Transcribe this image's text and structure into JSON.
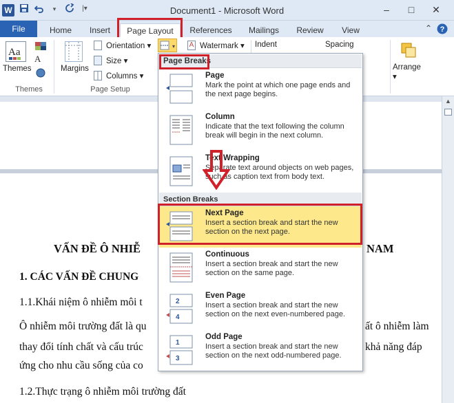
{
  "window": {
    "title": "Document1  -  Microsoft Word",
    "app_icon_letter": "W",
    "controls": [
      "–",
      "□",
      "✕"
    ]
  },
  "tabs": [
    "File",
    "Home",
    "Insert",
    "Page Layout",
    "References",
    "Mailings",
    "Review",
    "View"
  ],
  "ribbon": {
    "themes": {
      "button": "Themes",
      "group": "Themes"
    },
    "page_setup": {
      "margins": "Margins",
      "orientation": "Orientation ▾",
      "size": "Size ▾",
      "columns": "Columns ▾",
      "group": "Page Setup"
    },
    "watermark": "Watermark ▾",
    "indent": "Indent",
    "spacing": "Spacing",
    "arrange": "Arrange ▾"
  },
  "menu": {
    "page_breaks_header": "Page Breaks",
    "section_breaks_header": "Section Breaks",
    "items": [
      {
        "title": "Page",
        "desc": "Mark the point at which one page ends and the next page begins."
      },
      {
        "title": "Column",
        "desc": "Indicate that the text following the column break will begin in the next column."
      },
      {
        "title": "Text Wrapping",
        "desc": "Separate text around objects on web pages, such as caption text from body text."
      },
      {
        "title": "Next Page",
        "desc": "Insert a section break and start the new section on the next page."
      },
      {
        "title": "Continuous",
        "desc": "Insert a section break and start the new section on the same page."
      },
      {
        "title": "Even Page",
        "desc": "Insert a section break and start the new section on the next even-numbered page."
      },
      {
        "title": "Odd Page",
        "desc": "Insert a section break and start the new section on the next odd-numbered page."
      }
    ],
    "even_icon_numbers": [
      "2",
      "4"
    ],
    "odd_icon_numbers": [
      "1",
      "3"
    ]
  },
  "document": {
    "heading_left": "VẤN ĐỀ Ô NHIỄ",
    "heading_right": "NAM",
    "section1": "1. CÁC VẤN ĐỀ CHUNG",
    "sub1": "1.1.Khái niệm ô nhiễm môi t",
    "para1_left": "Ô nhiễm môi trường đất là qu",
    "para1_right": "ất ô nhiễm làm",
    "para2_left": "thay đổi tính chất và cấu trúc",
    "para2_right": "khả năng đáp",
    "para3_left": "ứng cho nhu cầu sống của co",
    "sub2": "1.2.Thực trạng ô nhiễm môi trường đất"
  },
  "colors": {
    "accent": "#2b579a",
    "highlight": "#fde98c",
    "annotation_red": "#d0202a"
  }
}
